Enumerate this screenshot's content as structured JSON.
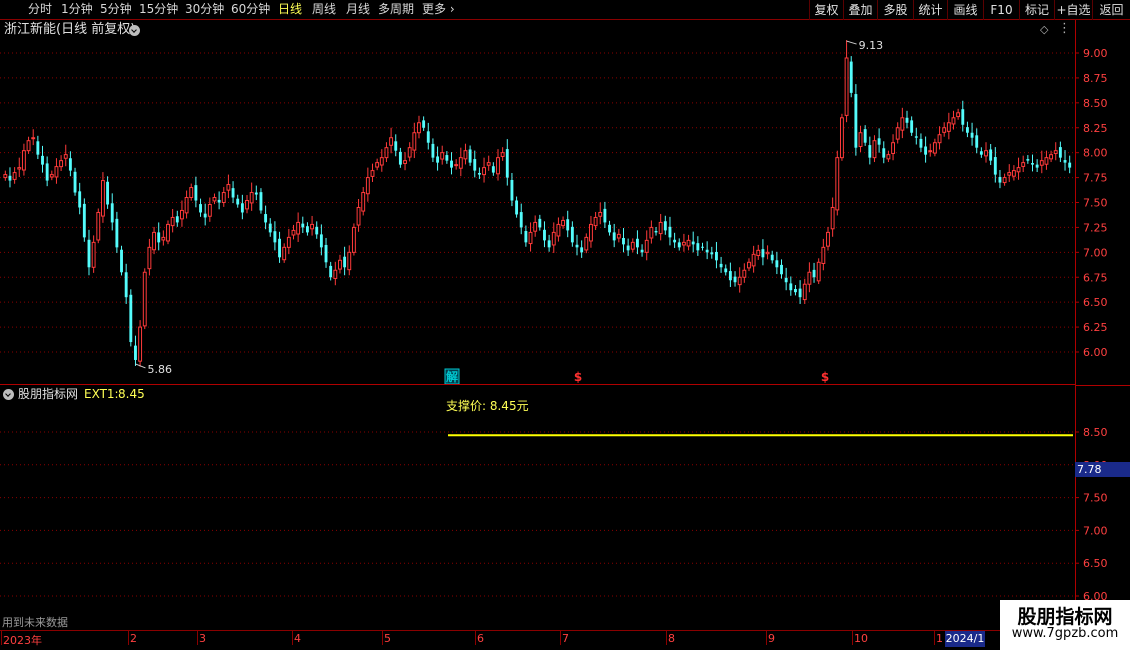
{
  "toolbar": {
    "periods": [
      "分时",
      "1分钟",
      "5分钟",
      "15分钟",
      "30分钟",
      "60分钟",
      "日线",
      "周线",
      "月线",
      "多周期",
      "更多"
    ],
    "active_period": "日线",
    "buttons": [
      "复权",
      "叠加",
      "多股",
      "统计",
      "画线",
      "F10",
      "标记",
      "+自选",
      "返回"
    ]
  },
  "main": {
    "stock_title": "浙江新能(日线 前复权)",
    "high_label": "9.13",
    "low_label": "5.86",
    "markers": [
      {
        "label": "解",
        "color": "#00c8d0",
        "boxed": true
      },
      {
        "label": "$",
        "color": "#ff3030",
        "boxed": false
      },
      {
        "label": "$",
        "color": "#ff3030",
        "boxed": false
      }
    ],
    "yaxis": [
      "9.00",
      "8.75",
      "8.50",
      "8.25",
      "8.00",
      "7.75",
      "7.50",
      "7.25",
      "7.00",
      "6.75",
      "6.50",
      "6.25",
      "6.00"
    ]
  },
  "indicator": {
    "name": "股朋指标网",
    "ext_label": "EXT1:",
    "ext_value": "8.45",
    "support_text": "支撑价: 8.45元",
    "yaxis": [
      "8.50",
      "8.00",
      "7.50",
      "7.00",
      "6.50",
      "6.00"
    ],
    "current_price_tag": "7.78",
    "future_note": "用到未来数据"
  },
  "dates": {
    "labels": [
      "2023年",
      "2",
      "3",
      "4",
      "5",
      "6",
      "7",
      "8",
      "9",
      "10",
      "1"
    ],
    "year_tag": "2024/1"
  },
  "watermark": {
    "line1": "股朋指标网",
    "line2": "www.7gpzb.com"
  },
  "colors": {
    "up": "#ff3a3a",
    "down": "#54fcfc",
    "grid": "#8a0000",
    "line": "#ffff00"
  },
  "chart_data": {
    "type": "candlestick",
    "price_range": [
      5.75,
      9.25
    ],
    "support_price": 8.45,
    "close_series": [
      7.78,
      7.72,
      7.8,
      7.85,
      8.02,
      8.12,
      8.15,
      7.98,
      7.88,
      7.72,
      7.78,
      7.86,
      7.92,
      7.98,
      7.82,
      7.6,
      7.45,
      7.15,
      6.85,
      7.1,
      7.4,
      7.72,
      7.48,
      7.3,
      7.05,
      6.8,
      6.55,
      6.1,
      5.92,
      6.25,
      6.8,
      7.05,
      7.2,
      7.1,
      7.15,
      7.28,
      7.35,
      7.3,
      7.42,
      7.55,
      7.65,
      7.52,
      7.4,
      7.35,
      7.48,
      7.55,
      7.5,
      7.6,
      7.68,
      7.55,
      7.48,
      7.4,
      7.52,
      7.6,
      7.58,
      7.42,
      7.3,
      7.2,
      7.1,
      6.95,
      7.05,
      7.15,
      7.22,
      7.3,
      7.25,
      7.2,
      7.28,
      7.18,
      7.05,
      6.9,
      6.75,
      6.82,
      6.92,
      6.85,
      7.0,
      7.25,
      7.45,
      7.6,
      7.75,
      7.82,
      7.9,
      7.95,
      8.05,
      8.15,
      8.02,
      7.88,
      7.92,
      8.05,
      8.2,
      8.3,
      8.25,
      8.1,
      7.95,
      7.9,
      8.0,
      7.92,
      7.85,
      7.88,
      7.95,
      8.02,
      7.9,
      7.82,
      7.78,
      7.85,
      7.9,
      7.8,
      7.95,
      8.0,
      7.75,
      7.52,
      7.38,
      7.25,
      7.1,
      7.2,
      7.3,
      7.25,
      7.12,
      7.05,
      7.2,
      7.28,
      7.32,
      7.22,
      7.1,
      7.05,
      7.0,
      7.15,
      7.28,
      7.35,
      7.4,
      7.3,
      7.2,
      7.12,
      7.18,
      7.08,
      7.02,
      7.1,
      7.05,
      7.0,
      7.12,
      7.25,
      7.2,
      7.3,
      7.22,
      7.15,
      7.1,
      7.05,
      7.1,
      7.12,
      7.08,
      7.02,
      7.05,
      7.0,
      6.98,
      6.92,
      6.85,
      6.8,
      6.72,
      6.7,
      6.75,
      6.82,
      6.9,
      6.98,
      7.02,
      6.95,
      7.0,
      6.92,
      6.85,
      6.78,
      6.7,
      6.62,
      6.6,
      6.55,
      6.68,
      6.8,
      6.75,
      6.9,
      7.05,
      7.2,
      7.45,
      7.95,
      8.35,
      8.95,
      8.6,
      8.05,
      8.2,
      8.1,
      7.95,
      8.12,
      8.08,
      7.95,
      7.98,
      8.1,
      8.25,
      8.35,
      8.3,
      8.2,
      8.15,
      8.05,
      7.98,
      8.02,
      8.1,
      8.18,
      8.25,
      8.3,
      8.35,
      8.4,
      8.28,
      8.2,
      8.15,
      8.05,
      7.98,
      8.02,
      7.92,
      7.78,
      7.7,
      7.75,
      7.8,
      7.82,
      7.85,
      7.9,
      7.92,
      7.88,
      7.85,
      7.92,
      7.95,
      7.98,
      8.02,
      7.95,
      7.9,
      7.85
    ]
  }
}
